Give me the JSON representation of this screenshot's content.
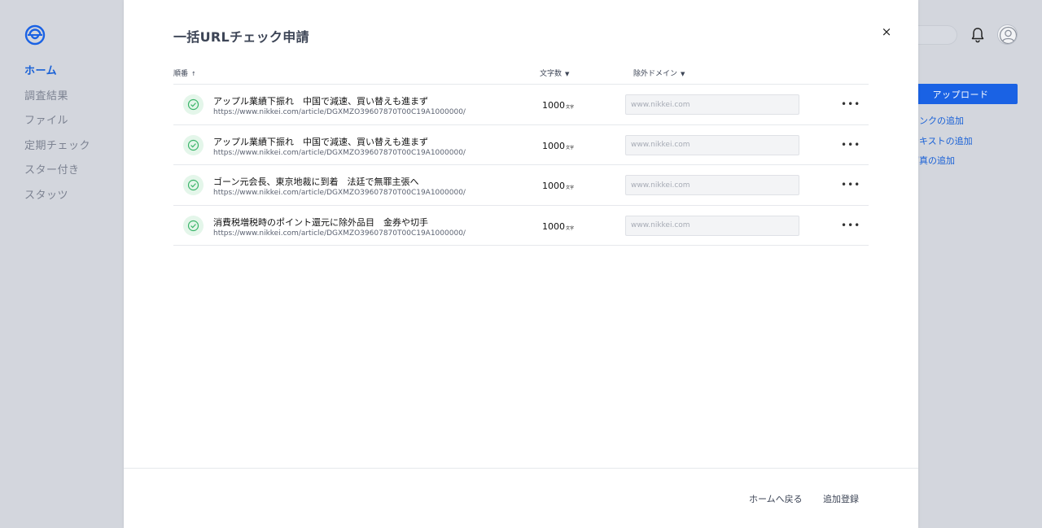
{
  "sidebar": {
    "items": [
      {
        "label": "ホーム",
        "active": true
      },
      {
        "label": "調査結果",
        "active": false
      },
      {
        "label": "ファイル",
        "active": false
      },
      {
        "label": "定期チェック",
        "active": false
      },
      {
        "label": "スター付き",
        "active": false
      },
      {
        "label": "スタッツ",
        "active": false
      }
    ]
  },
  "right_panel": {
    "upload_label": "アップロード",
    "links": [
      "リンクの追加",
      "テキストの追加",
      "写真の追加"
    ]
  },
  "modal": {
    "title": "一括URLチェック申請",
    "close_label": "×",
    "columns": {
      "order": "順番",
      "chars": "文字数",
      "domain": "除外ドメイン"
    },
    "count_unit": "文字",
    "more_label": "•••",
    "rows": [
      {
        "title": "アップル業績下振れ　中国で減速、買い替えも進まず",
        "url": "https://www.nikkei.com/article/DGXMZO39607870T00C19A1000000/",
        "count": "1000",
        "domain_placeholder": "www.nikkei.com"
      },
      {
        "title": "アップル業績下振れ　中国で減速、買い替えも進まず",
        "url": "https://www.nikkei.com/article/DGXMZO39607870T00C19A1000000/",
        "count": "1000",
        "domain_placeholder": "www.nikkei.com"
      },
      {
        "title": "ゴーン元会長、東京地裁に到着　法廷で無罪主張へ",
        "url": "https://www.nikkei.com/article/DGXMZO39607870T00C19A1000000/",
        "count": "1000",
        "domain_placeholder": "www.nikkei.com"
      },
      {
        "title": "消費税増税時のポイント還元に除外品目　金券や切手",
        "url": "https://www.nikkei.com/article/DGXMZO39607870T00C19A1000000/",
        "count": "1000",
        "domain_placeholder": "www.nikkei.com"
      }
    ],
    "footer": {
      "back_label": "ホームへ戻る",
      "submit_label": "追加登録"
    }
  },
  "colors": {
    "accent": "#1a62e4",
    "success_bg": "#e4f6ea",
    "success": "#3bb56a"
  },
  "icons": [
    "logo-icon",
    "bell-icon",
    "avatar-icon",
    "check-circle-icon",
    "sort-up-icon",
    "sort-down-icon",
    "more-icon",
    "close-icon"
  ]
}
